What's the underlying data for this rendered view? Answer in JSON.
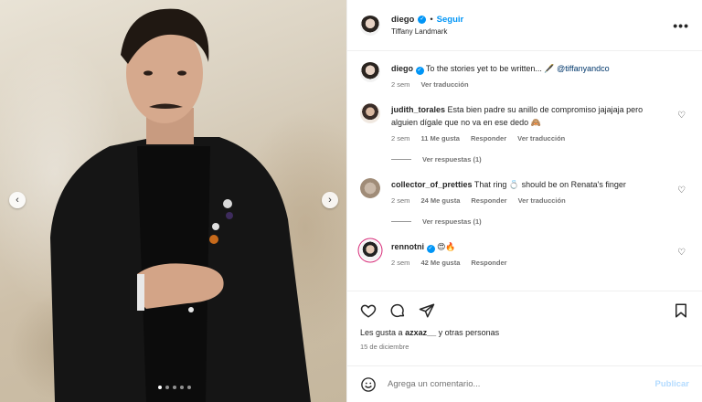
{
  "header": {
    "username": "diego",
    "separator": "•",
    "follow_label": "Seguir",
    "location": "Tiffany Landmark",
    "more_label": "•••"
  },
  "caption": {
    "username": "diego",
    "text": "To the stories yet to be written... 🖋️",
    "mention": "@tiffanyandco",
    "time": "2 sem",
    "translate": "Ver traducción"
  },
  "comments": [
    {
      "username": "judith_torales",
      "text": "Esta bien padre su anillo de compromiso jajajaja pero alguien dígale que no va en ese dedo 🙈",
      "time": "2 sem",
      "likes": "11 Me gusta",
      "reply": "Responder",
      "translate": "Ver traducción",
      "replies": "Ver respuestas (1)"
    },
    {
      "username": "collector_of_pretties",
      "text": "That ring 💍 should be on Renata's finger",
      "time": "2 sem",
      "likes": "24 Me gusta",
      "reply": "Responder",
      "translate": "Ver traducción",
      "replies": "Ver respuestas (1)"
    },
    {
      "username": "rennotni",
      "text": "😍🔥",
      "time": "2 sem",
      "likes": "42 Me gusta",
      "reply": "Responder"
    }
  ],
  "actions": {
    "likes_prefix": "Les gusta a",
    "likes_user": "azxaz__",
    "likes_suffix": "y otras personas",
    "date": "15 de diciembre"
  },
  "composer": {
    "placeholder": "Agrega un comentario...",
    "publish": "Publicar"
  },
  "photo": {
    "prev_label": "‹",
    "next_label": "›"
  },
  "colors": {
    "accent": "#0095f6",
    "link": "#00376b",
    "muted": "#737373"
  }
}
